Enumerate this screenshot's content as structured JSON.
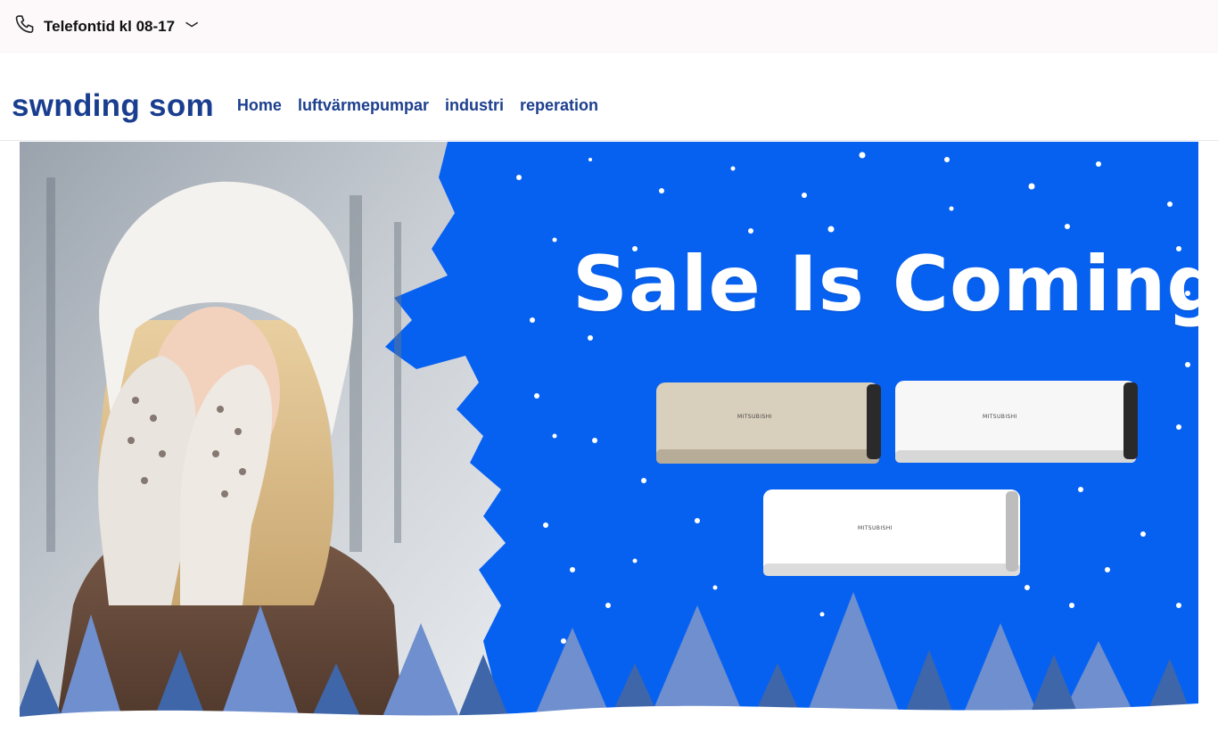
{
  "topbar": {
    "phone_label": "Telefontid kl 08-17",
    "chevron": "﹀",
    "icon": "phone-icon"
  },
  "header": {
    "brand": "swnding som",
    "nav": [
      {
        "label": "Home"
      },
      {
        "label": "luftvärmepumpar"
      },
      {
        "label": "industri"
      },
      {
        "label": "reperation"
      }
    ]
  },
  "banner": {
    "headline": "Sale Is Coming!",
    "unit_brand": "MITSUBISHI",
    "colors": {
      "background": "#0761f0",
      "tree_light": "#6f8fce",
      "tree_dark": "#3f66a8",
      "snow": "#ffffff"
    }
  },
  "colors": {
    "brand": "#1a3e8f",
    "nav": "#1c3f8e",
    "topbar_bg": "#fdf9fa"
  }
}
